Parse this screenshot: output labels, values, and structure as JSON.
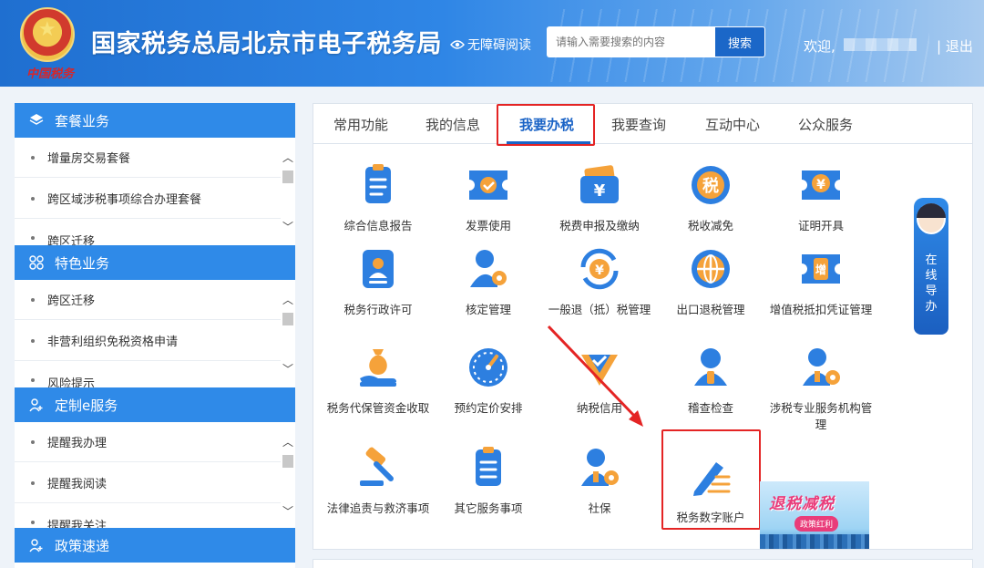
{
  "header": {
    "title": "国家税务总局北京市电子税务局",
    "emblem_subtitle": "中国税务",
    "accessibility": "无障碍阅读",
    "search_placeholder": "请输入需要搜索的内容",
    "search_button": "搜索",
    "welcome": "欢迎,",
    "logout": "| 退出"
  },
  "sidebar": {
    "sections": [
      {
        "title": "套餐业务",
        "items": [
          "增量房交易套餐",
          "跨区域涉税事项综合办理套餐",
          "跨区迁移"
        ]
      },
      {
        "title": "特色业务",
        "items": [
          "跨区迁移",
          "非营利组织免税资格申请",
          "风险提示"
        ]
      },
      {
        "title": "定制e服务",
        "items": [
          "提醒我办理",
          "提醒我阅读",
          "提醒我关注"
        ]
      },
      {
        "title": "政策速递",
        "items": []
      }
    ]
  },
  "tabs": [
    "常用功能",
    "我的信息",
    "我要办税",
    "我要查询",
    "互动中心",
    "公众服务"
  ],
  "active_tab": "我要办税",
  "services": [
    {
      "label": "综合信息报告",
      "icon": "report-icon"
    },
    {
      "label": "发票使用",
      "icon": "invoice-icon"
    },
    {
      "label": "税费申报及缴纳",
      "icon": "tax-payment-icon"
    },
    {
      "label": "税收减免",
      "icon": "tax-relief-icon"
    },
    {
      "label": "证明开具",
      "icon": "certificate-icon"
    },
    {
      "label": "税务行政许可",
      "icon": "admin-permit-icon"
    },
    {
      "label": "核定管理",
      "icon": "verification-icon"
    },
    {
      "label": "一般退（抵）税管理",
      "icon": "tax-refund-icon"
    },
    {
      "label": "出口退税管理",
      "icon": "export-refund-icon"
    },
    {
      "label": "增值税抵扣凭证管理",
      "icon": "vat-voucher-icon"
    },
    {
      "label": "税务代保管资金收取",
      "icon": "custody-fund-icon"
    },
    {
      "label": "预约定价安排",
      "icon": "pricing-arrangement-icon"
    },
    {
      "label": "纳税信用",
      "icon": "tax-credit-icon"
    },
    {
      "label": "稽查检查",
      "icon": "inspection-icon"
    },
    {
      "label": "涉税专业服务机构管理",
      "icon": "agency-management-icon"
    },
    {
      "label": "法律追责与救济事项",
      "icon": "legal-gavel-icon"
    },
    {
      "label": "其它服务事项",
      "icon": "other-services-icon"
    },
    {
      "label": "社保",
      "icon": "social-security-icon"
    },
    {
      "label": "税务数字账户",
      "icon": "digital-account-icon"
    }
  ],
  "guide": {
    "chars": [
      "在",
      "线",
      "导",
      "办"
    ]
  },
  "banner": {
    "title": "退税减税",
    "subtitle": "政策红利"
  },
  "colors": {
    "primary": "#2f8ae8",
    "active_tab": "#1a63c6",
    "highlight_red": "#e42424",
    "icon_blue": "#2d7fe0",
    "icon_orange": "#f5a23a"
  }
}
